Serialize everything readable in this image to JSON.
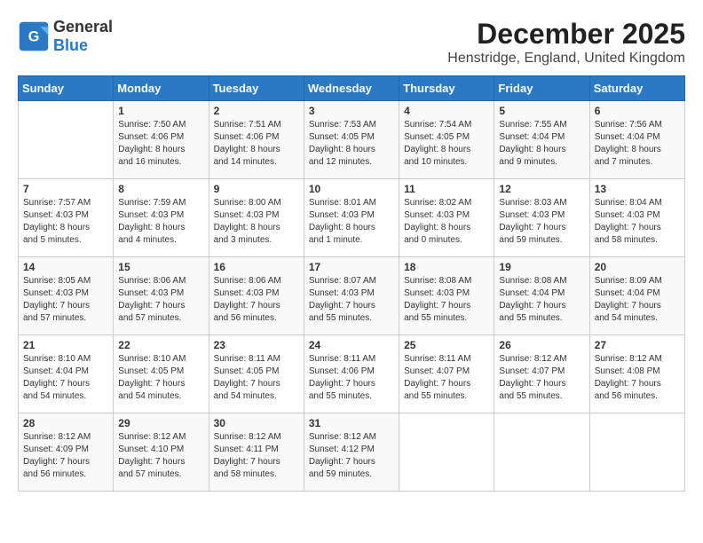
{
  "header": {
    "logo_general": "General",
    "logo_blue": "Blue",
    "month_title": "December 2025",
    "subtitle": "Henstridge, England, United Kingdom"
  },
  "columns": [
    "Sunday",
    "Monday",
    "Tuesday",
    "Wednesday",
    "Thursday",
    "Friday",
    "Saturday"
  ],
  "weeks": [
    [
      {
        "day": "",
        "info": ""
      },
      {
        "day": "1",
        "info": "Sunrise: 7:50 AM\nSunset: 4:06 PM\nDaylight: 8 hours\nand 16 minutes."
      },
      {
        "day": "2",
        "info": "Sunrise: 7:51 AM\nSunset: 4:06 PM\nDaylight: 8 hours\nand 14 minutes."
      },
      {
        "day": "3",
        "info": "Sunrise: 7:53 AM\nSunset: 4:05 PM\nDaylight: 8 hours\nand 12 minutes."
      },
      {
        "day": "4",
        "info": "Sunrise: 7:54 AM\nSunset: 4:05 PM\nDaylight: 8 hours\nand 10 minutes."
      },
      {
        "day": "5",
        "info": "Sunrise: 7:55 AM\nSunset: 4:04 PM\nDaylight: 8 hours\nand 9 minutes."
      },
      {
        "day": "6",
        "info": "Sunrise: 7:56 AM\nSunset: 4:04 PM\nDaylight: 8 hours\nand 7 minutes."
      }
    ],
    [
      {
        "day": "7",
        "info": "Sunrise: 7:57 AM\nSunset: 4:03 PM\nDaylight: 8 hours\nand 5 minutes."
      },
      {
        "day": "8",
        "info": "Sunrise: 7:59 AM\nSunset: 4:03 PM\nDaylight: 8 hours\nand 4 minutes."
      },
      {
        "day": "9",
        "info": "Sunrise: 8:00 AM\nSunset: 4:03 PM\nDaylight: 8 hours\nand 3 minutes."
      },
      {
        "day": "10",
        "info": "Sunrise: 8:01 AM\nSunset: 4:03 PM\nDaylight: 8 hours\nand 1 minute."
      },
      {
        "day": "11",
        "info": "Sunrise: 8:02 AM\nSunset: 4:03 PM\nDaylight: 8 hours\nand 0 minutes."
      },
      {
        "day": "12",
        "info": "Sunrise: 8:03 AM\nSunset: 4:03 PM\nDaylight: 7 hours\nand 59 minutes."
      },
      {
        "day": "13",
        "info": "Sunrise: 8:04 AM\nSunset: 4:03 PM\nDaylight: 7 hours\nand 58 minutes."
      }
    ],
    [
      {
        "day": "14",
        "info": "Sunrise: 8:05 AM\nSunset: 4:03 PM\nDaylight: 7 hours\nand 57 minutes."
      },
      {
        "day": "15",
        "info": "Sunrise: 8:06 AM\nSunset: 4:03 PM\nDaylight: 7 hours\nand 57 minutes."
      },
      {
        "day": "16",
        "info": "Sunrise: 8:06 AM\nSunset: 4:03 PM\nDaylight: 7 hours\nand 56 minutes."
      },
      {
        "day": "17",
        "info": "Sunrise: 8:07 AM\nSunset: 4:03 PM\nDaylight: 7 hours\nand 55 minutes."
      },
      {
        "day": "18",
        "info": "Sunrise: 8:08 AM\nSunset: 4:03 PM\nDaylight: 7 hours\nand 55 minutes."
      },
      {
        "day": "19",
        "info": "Sunrise: 8:08 AM\nSunset: 4:04 PM\nDaylight: 7 hours\nand 55 minutes."
      },
      {
        "day": "20",
        "info": "Sunrise: 8:09 AM\nSunset: 4:04 PM\nDaylight: 7 hours\nand 54 minutes."
      }
    ],
    [
      {
        "day": "21",
        "info": "Sunrise: 8:10 AM\nSunset: 4:04 PM\nDaylight: 7 hours\nand 54 minutes."
      },
      {
        "day": "22",
        "info": "Sunrise: 8:10 AM\nSunset: 4:05 PM\nDaylight: 7 hours\nand 54 minutes."
      },
      {
        "day": "23",
        "info": "Sunrise: 8:11 AM\nSunset: 4:05 PM\nDaylight: 7 hours\nand 54 minutes."
      },
      {
        "day": "24",
        "info": "Sunrise: 8:11 AM\nSunset: 4:06 PM\nDaylight: 7 hours\nand 55 minutes."
      },
      {
        "day": "25",
        "info": "Sunrise: 8:11 AM\nSunset: 4:07 PM\nDaylight: 7 hours\nand 55 minutes."
      },
      {
        "day": "26",
        "info": "Sunrise: 8:12 AM\nSunset: 4:07 PM\nDaylight: 7 hours\nand 55 minutes."
      },
      {
        "day": "27",
        "info": "Sunrise: 8:12 AM\nSunset: 4:08 PM\nDaylight: 7 hours\nand 56 minutes."
      }
    ],
    [
      {
        "day": "28",
        "info": "Sunrise: 8:12 AM\nSunset: 4:09 PM\nDaylight: 7 hours\nand 56 minutes."
      },
      {
        "day": "29",
        "info": "Sunrise: 8:12 AM\nSunset: 4:10 PM\nDaylight: 7 hours\nand 57 minutes."
      },
      {
        "day": "30",
        "info": "Sunrise: 8:12 AM\nSunset: 4:11 PM\nDaylight: 7 hours\nand 58 minutes."
      },
      {
        "day": "31",
        "info": "Sunrise: 8:12 AM\nSunset: 4:12 PM\nDaylight: 7 hours\nand 59 minutes."
      },
      {
        "day": "",
        "info": ""
      },
      {
        "day": "",
        "info": ""
      },
      {
        "day": "",
        "info": ""
      }
    ]
  ]
}
